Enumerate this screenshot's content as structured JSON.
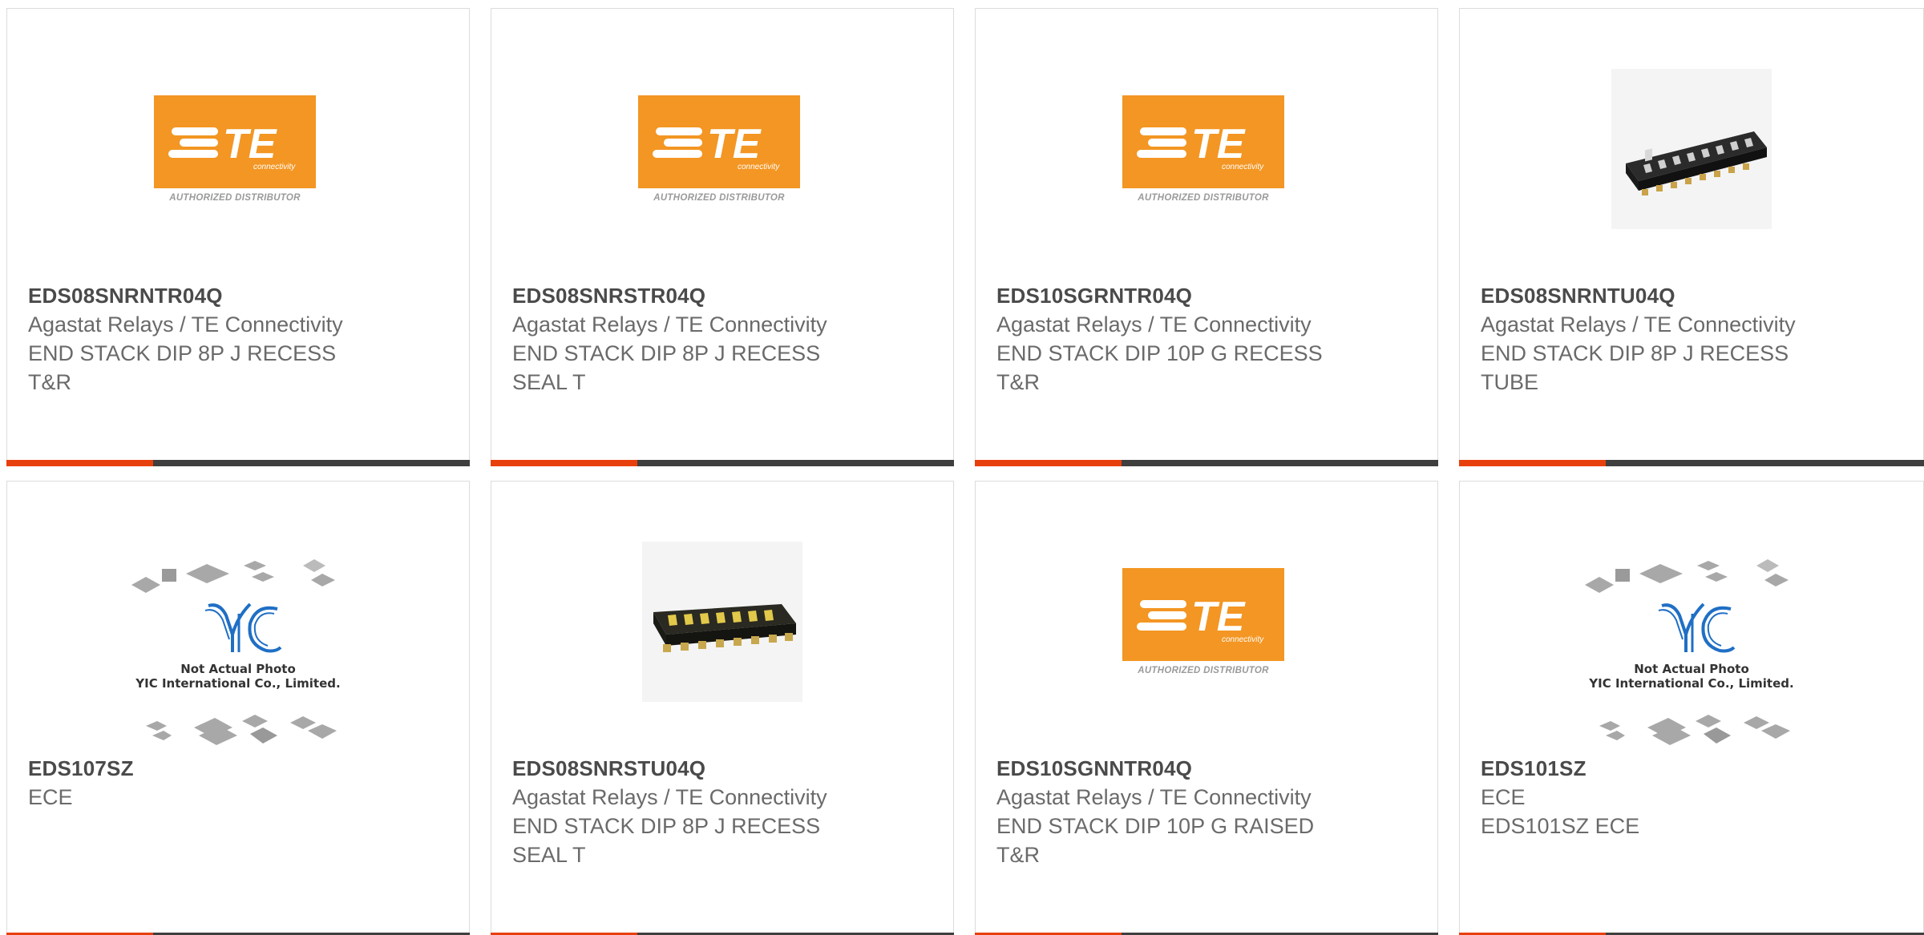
{
  "products": [
    {
      "part_number": "EDS08SNRNTR04Q",
      "manufacturer": "Agastat Relays / TE Connectivity",
      "desc_line1": "END STACK DIP 8P J RECESS",
      "desc_line2": "T&R",
      "image": "te-logo"
    },
    {
      "part_number": "EDS08SNRSTR04Q",
      "manufacturer": "Agastat Relays / TE Connectivity",
      "desc_line1": "END STACK DIP 8P J RECESS",
      "desc_line2": "SEAL T",
      "image": "te-logo"
    },
    {
      "part_number": "EDS10SGRNTR04Q",
      "manufacturer": "Agastat Relays / TE Connectivity",
      "desc_line1": "END STACK DIP 10P G RECESS",
      "desc_line2": "T&R",
      "image": "te-logo"
    },
    {
      "part_number": "EDS08SNRNTU04Q",
      "manufacturer": "Agastat Relays / TE Connectivity",
      "desc_line1": "END STACK DIP 8P J RECESS",
      "desc_line2": "TUBE",
      "image": "dip-switch-photo-black"
    },
    {
      "part_number": "EDS107SZ",
      "manufacturer": "ECE",
      "desc_line1": "",
      "desc_line2": "",
      "image": "yic-placeholder"
    },
    {
      "part_number": "EDS08SNRSTU04Q",
      "manufacturer": "Agastat Relays / TE Connectivity",
      "desc_line1": "END STACK DIP 8P J RECESS",
      "desc_line2": "SEAL T",
      "image": "dip-switch-photo-yellow"
    },
    {
      "part_number": "EDS10SGNNTR04Q",
      "manufacturer": "Agastat Relays / TE Connectivity",
      "desc_line1": "END STACK DIP 10P G RAISED",
      "desc_line2": "T&R",
      "image": "te-logo"
    },
    {
      "part_number": "EDS101SZ",
      "manufacturer": "ECE",
      "desc_line1": "EDS101SZ ECE",
      "desc_line2": "",
      "image": "yic-placeholder"
    }
  ],
  "te_logo": {
    "wordmark": "TE",
    "tagline": "connectivity",
    "distributor_text": "AUTHORIZED DISTRIBUTOR"
  },
  "yic_placeholder": {
    "logo_text": "YIC",
    "line1": "Not Actual Photo",
    "line2": "YIC International Co., Limited."
  },
  "colors": {
    "accent_bar": "#e8400c",
    "dark_bar": "#3f3f3f",
    "te_orange": "#f39623",
    "part_number": "#4a4a4a",
    "body_text": "#6a6a6a",
    "yic_blue": "#1f6fc5"
  }
}
